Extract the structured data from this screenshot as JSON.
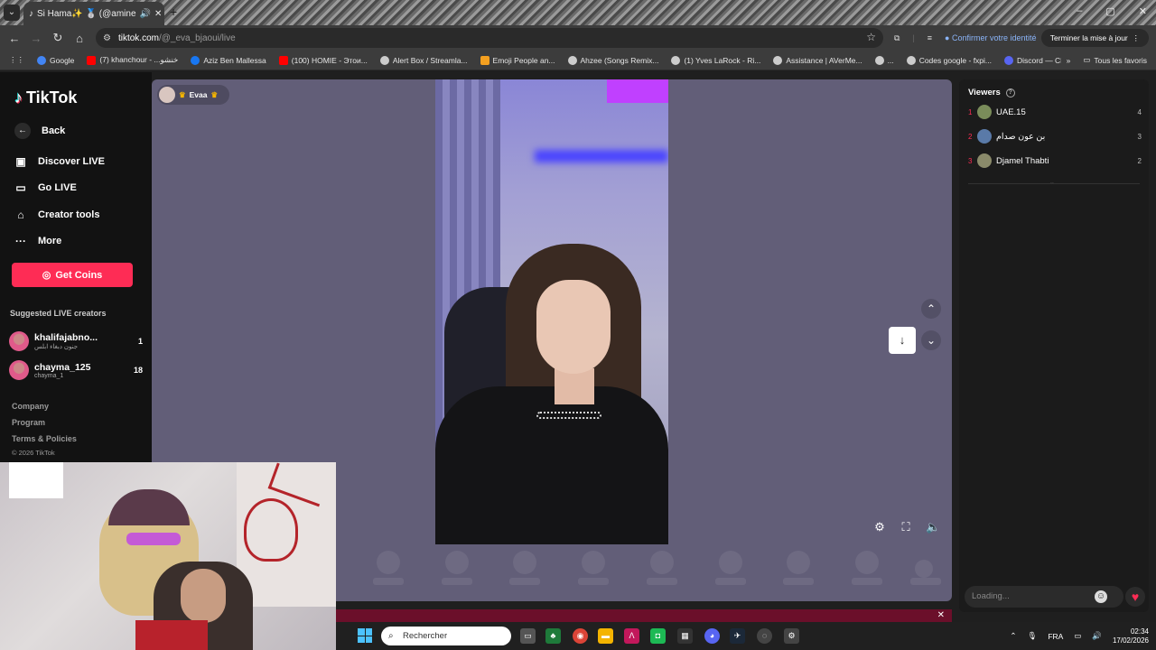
{
  "browser": {
    "tab_title": "Si Hama✨ 🥈 (@amine",
    "url_host": "tiktok.com",
    "url_path": "/@_eva_bjaoui/live",
    "identity_label": "Confirmer votre identité",
    "finish_update_label": "Terminer la mise à jour",
    "bookmarks": [
      {
        "label": "Google",
        "color": "#4285f4"
      },
      {
        "label": "(7) khanchour - ...خنشو",
        "color": "#ff0000"
      },
      {
        "label": "Aziz Ben Mallessa",
        "color": "#1877f2"
      },
      {
        "label": "(100) HOMIE - Этои...",
        "color": "#ff0000"
      },
      {
        "label": "Alert Box / Streamla...",
        "color": "#cccccc"
      },
      {
        "label": "Emoji People an...",
        "color": "#f4a020"
      },
      {
        "label": "Ahzee (Songs Remix...",
        "color": "#cccccc"
      },
      {
        "label": "(1) Yves LaRock - Ri...",
        "color": "#cccccc"
      },
      {
        "label": "Assistance | AVerMe...",
        "color": "#cccccc"
      },
      {
        "label": "...",
        "color": "#cccccc"
      },
      {
        "label": "Codes google - fxpi...",
        "color": "#cccccc"
      },
      {
        "label": "Discord — Chat voc...",
        "color": "#5865f2"
      }
    ],
    "all_bookmarks_label": "Tous les favoris"
  },
  "sidebar": {
    "logo_text": "TikTok",
    "back_label": "Back",
    "nav": [
      {
        "label": "Discover LIVE",
        "icon": "calendar-icon"
      },
      {
        "label": "Go LIVE",
        "icon": "camera-icon"
      },
      {
        "label": "Creator tools",
        "icon": "creator-tools-icon"
      },
      {
        "label": "More",
        "icon": "more-icon"
      }
    ],
    "get_coins_label": "Get Coins",
    "suggested_title": "Suggested LIVE creators",
    "creators": [
      {
        "name": "khalifajabno...",
        "sub": "جنون دبغاء ابلس",
        "count": "1"
      },
      {
        "name": "chayma_125",
        "sub": "chayma_1",
        "count": "18"
      }
    ],
    "footer": [
      "Company",
      "Program",
      "Terms & Policies"
    ],
    "copyright": "© 2026 TikTok"
  },
  "stage": {
    "host_name": "Evaa"
  },
  "viewers": {
    "title": "Viewers",
    "list": [
      {
        "rank": "1",
        "name": "UAE.15",
        "score": "4",
        "color": "#7a8c5a"
      },
      {
        "rank": "2",
        "name": "بن عون صدام",
        "score": "3",
        "color": "#5a7aa8"
      },
      {
        "rank": "3",
        "name": "Djamel Thabti",
        "score": "2",
        "color": "#8a8a6a"
      }
    ],
    "chat_placeholder": "Loading..."
  },
  "taskbar": {
    "search_placeholder": "Rechercher",
    "language": "FRA",
    "time": "02:34",
    "date": "17/02/2026"
  },
  "colors": {
    "tiktok_red": "#fe2c55",
    "stage_bg": "#625e78"
  }
}
